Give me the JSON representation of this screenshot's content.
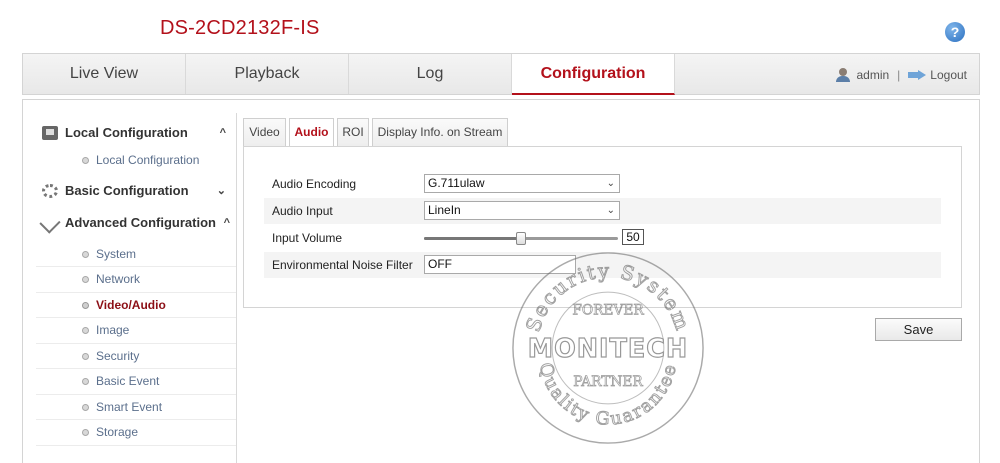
{
  "header": {
    "model": "DS-2CD2132F-IS",
    "help_label": "?"
  },
  "nav": {
    "tabs": [
      {
        "label": "Live View"
      },
      {
        "label": "Playback"
      },
      {
        "label": "Log"
      },
      {
        "label": "Configuration",
        "active": true
      }
    ],
    "user": "admin",
    "separator": "|",
    "logout": "Logout"
  },
  "sidebar": {
    "sections": [
      {
        "label": "Local Configuration",
        "chevron": "^",
        "icon": "computer-icon",
        "items": [
          {
            "label": "Local Configuration"
          }
        ]
      },
      {
        "label": "Basic Configuration",
        "chevron": "⌄",
        "icon": "gear-icon",
        "items": []
      },
      {
        "label": "Advanced Configuration",
        "chevron": "^",
        "icon": "wrench-icon",
        "items": [
          {
            "label": "System"
          },
          {
            "label": "Network"
          },
          {
            "label": "Video/Audio",
            "active": true
          },
          {
            "label": "Image"
          },
          {
            "label": "Security"
          },
          {
            "label": "Basic Event"
          },
          {
            "label": "Smart Event"
          },
          {
            "label": "Storage"
          }
        ]
      }
    ]
  },
  "subtabs": [
    {
      "label": "Video"
    },
    {
      "label": "Audio",
      "active": true
    },
    {
      "label": "ROI"
    },
    {
      "label": "Display Info. on Stream"
    }
  ],
  "form": {
    "audio_encoding": {
      "label": "Audio Encoding",
      "value": "G.711ulaw"
    },
    "audio_input": {
      "label": "Audio Input",
      "value": "LineIn"
    },
    "input_volume": {
      "label": "Input Volume",
      "value": "50",
      "level_percent": 50
    },
    "noise_filter": {
      "label": "Environmental Noise Filter",
      "value": "OFF"
    }
  },
  "save_label": "Save",
  "watermark": {
    "top_text": "Security System",
    "bottom_text": "Quality Guarantee",
    "brand": "MONITECH",
    "upper_banner": "FOREVER",
    "lower_banner": "PARTNER"
  },
  "colors": {
    "accent": "#b3111b",
    "link": "#5b6f8c"
  }
}
